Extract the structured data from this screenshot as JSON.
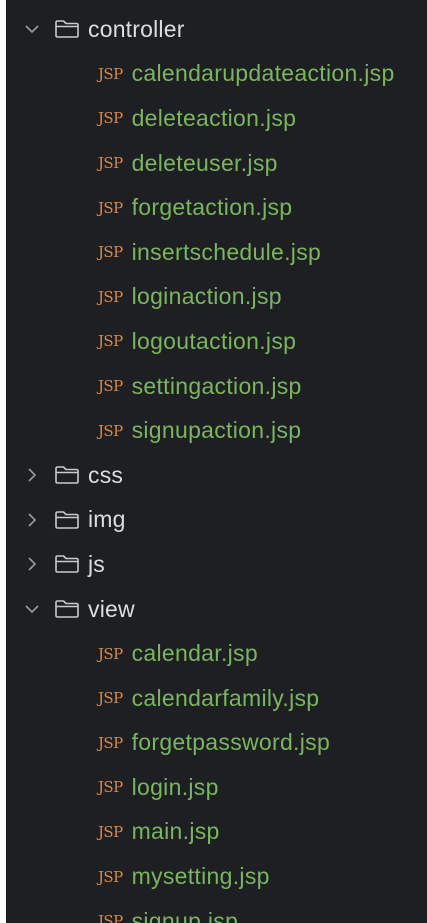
{
  "tree": {
    "controller": {
      "name": "controller",
      "expanded": true,
      "files": [
        {
          "tag": "JSP",
          "name": "calendarupdateaction.jsp"
        },
        {
          "tag": "JSP",
          "name": "deleteaction.jsp"
        },
        {
          "tag": "JSP",
          "name": "deleteuser.jsp"
        },
        {
          "tag": "JSP",
          "name": "forgetaction.jsp"
        },
        {
          "tag": "JSP",
          "name": "insertschedule.jsp"
        },
        {
          "tag": "JSP",
          "name": "loginaction.jsp"
        },
        {
          "tag": "JSP",
          "name": "logoutaction.jsp"
        },
        {
          "tag": "JSP",
          "name": "settingaction.jsp"
        },
        {
          "tag": "JSP",
          "name": "signupaction.jsp"
        }
      ]
    },
    "css": {
      "name": "css",
      "expanded": false
    },
    "img": {
      "name": "img",
      "expanded": false
    },
    "js": {
      "name": "js",
      "expanded": false
    },
    "view": {
      "name": "view",
      "expanded": true,
      "files": [
        {
          "tag": "JSP",
          "name": "calendar.jsp"
        },
        {
          "tag": "JSP",
          "name": "calendarfamily.jsp"
        },
        {
          "tag": "JSP",
          "name": "forgetpassword.jsp"
        },
        {
          "tag": "JSP",
          "name": "login.jsp"
        },
        {
          "tag": "JSP",
          "name": "main.jsp"
        },
        {
          "tag": "JSP",
          "name": "mysetting.jsp"
        },
        {
          "tag": "JSP",
          "name": "signup.jsp"
        }
      ]
    }
  },
  "colors": {
    "background": "#1e1f22",
    "folder_text": "#dcdde0",
    "file_text": "#7ab55f",
    "jsp_tag": "#d8894c"
  },
  "icons": {
    "expanded": "chevron-down-icon",
    "collapsed": "chevron-right-icon",
    "folder": "folder-icon"
  }
}
